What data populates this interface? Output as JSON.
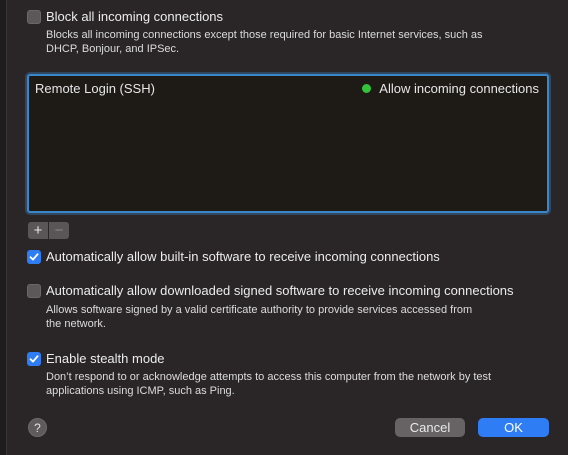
{
  "options": {
    "block_all": {
      "label": "Block all incoming connections",
      "checked": false,
      "description_line1": "Blocks all incoming connections except those required for basic Internet services, such as",
      "description_line2": "DHCP, Bonjour, and IPSec."
    },
    "auto_builtin": {
      "label": "Automatically allow built-in software to receive incoming connections",
      "checked": true
    },
    "auto_signed": {
      "label": "Automatically allow downloaded signed software to receive incoming connections",
      "checked": false,
      "description_line1": "Allows software signed by a valid certificate authority to provide services accessed from",
      "description_line2": "the network."
    },
    "stealth": {
      "label": "Enable stealth mode",
      "checked": true,
      "description_line1": "Don’t respond to or acknowledge attempts to access this computer from the network by test",
      "description_line2": "applications using ICMP, such as Ping."
    }
  },
  "services": [
    {
      "name": "Remote Login (SSH)",
      "status": "Allow incoming connections",
      "status_color": "#33c33b"
    }
  ],
  "list_controls": {
    "add": "+",
    "remove": "−"
  },
  "buttons": {
    "help": "?",
    "cancel": "Cancel",
    "ok": "OK"
  },
  "colors": {
    "accent": "#2f7df5",
    "focus_ring": "#3a86c9",
    "background": "#2a2627"
  }
}
